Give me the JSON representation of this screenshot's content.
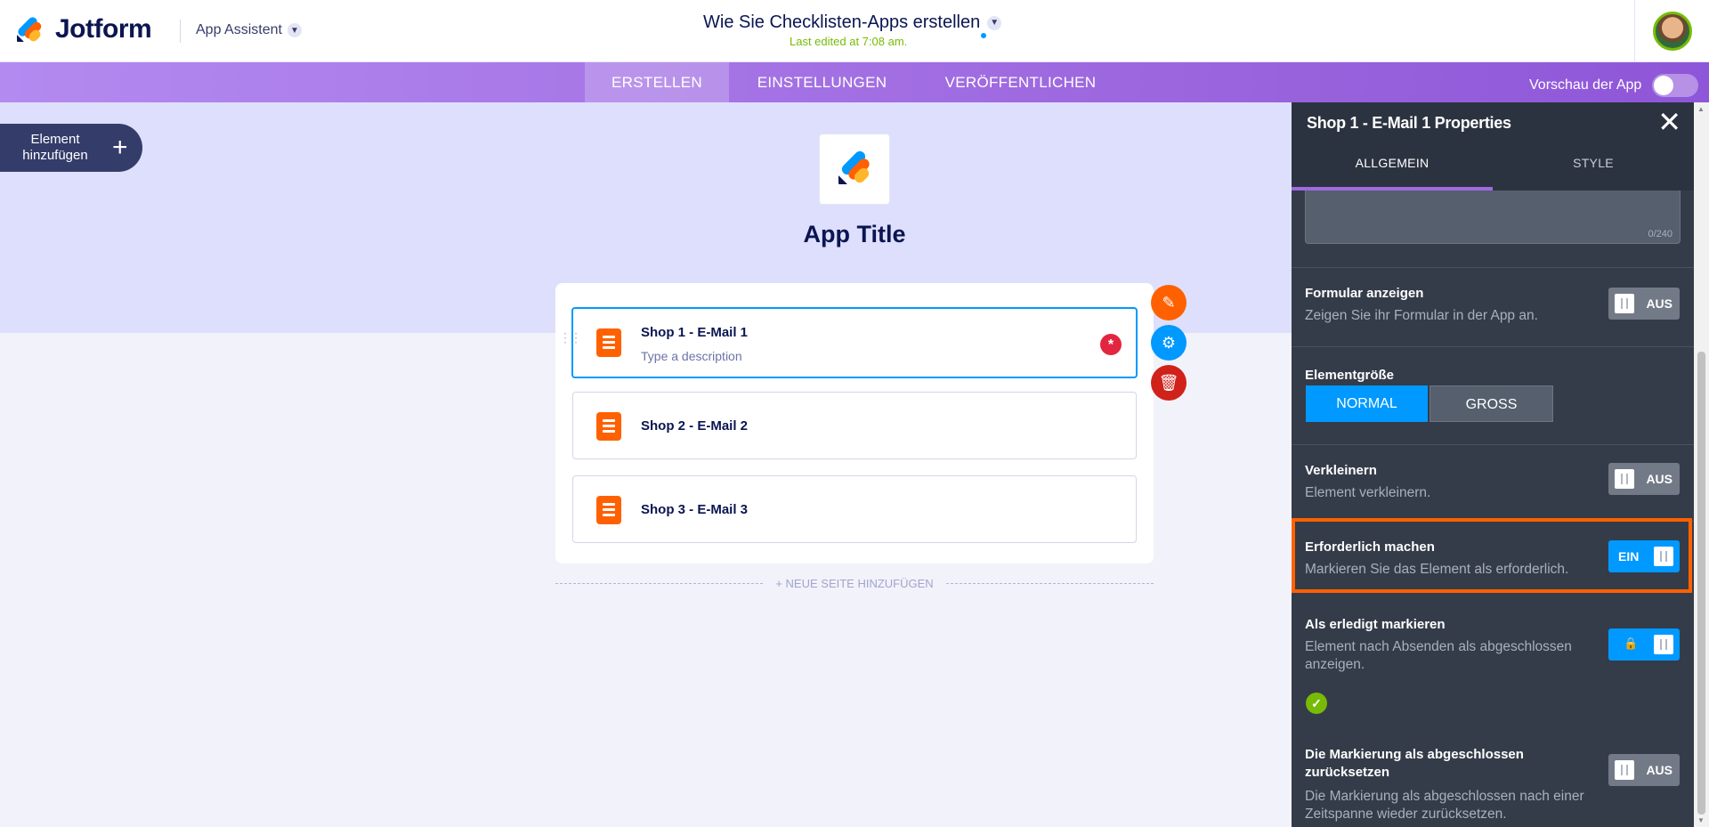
{
  "header": {
    "brand": "Jotform",
    "app_assistant": "App Assistent",
    "doc_title": "Wie Sie Checklisten-Apps erstellen",
    "last_edited": "Last edited at 7:08 am."
  },
  "nav": {
    "tabs": [
      {
        "label": "ERSTELLEN",
        "active": true
      },
      {
        "label": "EINSTELLUNGEN",
        "active": false
      },
      {
        "label": "VERÖFFENTLICHEN",
        "active": false
      }
    ],
    "preview_label": "Vorschau der App"
  },
  "builder": {
    "add_element_label": "Element hinzufügen",
    "app_title": "App Title",
    "items": [
      {
        "name": "Shop 1 - E-Mail 1",
        "description": "Type a description",
        "selected": true
      },
      {
        "name": "Shop 2 - E-Mail 2"
      },
      {
        "name": "Shop 3 - E-Mail 3"
      }
    ],
    "new_page_label": "+ NEUE SEITE HINZUFÜGEN"
  },
  "panel": {
    "title": "Shop 1 - E-Mail 1 Properties",
    "tabs": [
      "ALLGEMEIN",
      "STYLE"
    ],
    "char_count": "0/240",
    "props": {
      "show_form": {
        "title": "Formular anzeigen",
        "desc": "Zeigen Sie ihr Formular in der App an.",
        "toggle": "AUS"
      },
      "size": {
        "title": "Elementgröße",
        "options": [
          "NORMAL",
          "GROSS"
        ],
        "selected": "NORMAL"
      },
      "shrink": {
        "title": "Verkleinern",
        "desc": "Element verkleinern.",
        "toggle": "AUS"
      },
      "required": {
        "title": "Erforderlich machen",
        "desc": "Markieren Sie das Element als erforderlich.",
        "toggle": "EIN"
      },
      "mark_done": {
        "title": "Als erledigt markieren",
        "desc": "Element nach Absenden als abgeschlossen anzeigen.",
        "toggle": "on-locked"
      },
      "reset_done": {
        "title": "Die Markierung als abgeschlossen zurücksetzen",
        "desc": "Die Markierung als abgeschlossen nach einer Zeitspanne wieder zurücksetzen.",
        "toggle": "AUS"
      }
    }
  },
  "colors": {
    "accent": "#0099ff",
    "brand_orange": "#ff6100",
    "nav_purple": "#9f6ae0",
    "panel_bg": "#343c49",
    "highlight": "#ff6100"
  }
}
